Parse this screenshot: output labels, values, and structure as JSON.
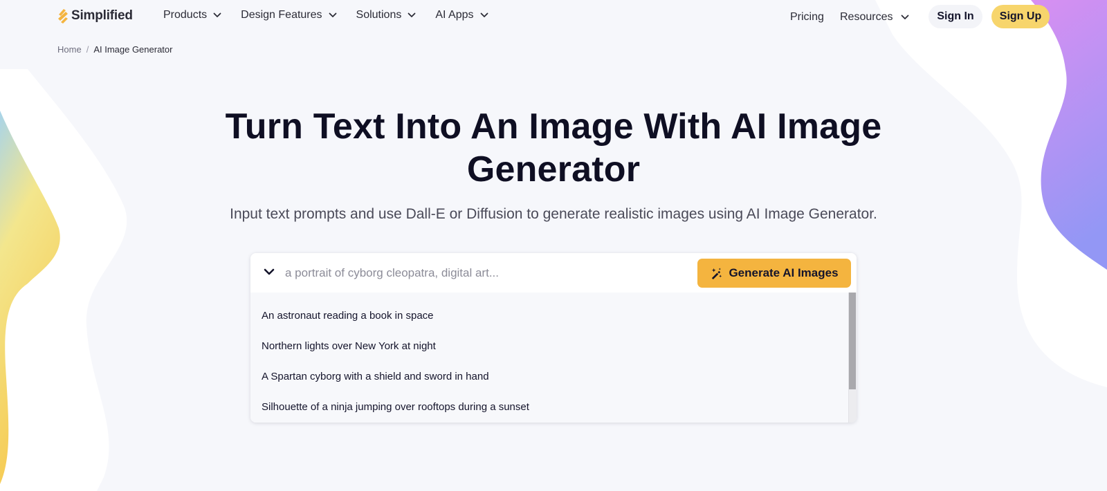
{
  "brand": {
    "name": "Simplified",
    "logo_icon": "simplified-logo-icon",
    "colors": {
      "accent_yellow": "#f7d56c",
      "button_orange": "#f4b43f",
      "text_dark": "#0f0f23",
      "page_bg": "#f6f7fb"
    }
  },
  "nav": {
    "left_items": [
      {
        "label": "Products",
        "icon": "chevron-down-icon"
      },
      {
        "label": "Design Features",
        "icon": "chevron-down-icon"
      },
      {
        "label": "Solutions",
        "icon": "chevron-down-icon"
      },
      {
        "label": "AI Apps",
        "icon": "chevron-down-icon"
      }
    ],
    "pricing_label": "Pricing",
    "resources_label": "Resources",
    "sign_in_label": "Sign In",
    "sign_up_label": "Sign Up"
  },
  "breadcrumb": {
    "home": "Home",
    "separator": "/",
    "current": "AI Image Generator"
  },
  "hero": {
    "title_line1": "Turn Text Into An Image With AI Image",
    "title_line2": "Generator",
    "subtitle": "Input text prompts and use Dall-E or Diffusion to generate realistic images using AI Image Generator."
  },
  "generator": {
    "input_value": "",
    "input_placeholder": "a portrait of cyborg cleopatra, digital art...",
    "toggle_icon": "chevron-down-icon",
    "button_icon": "magic-wand-icon",
    "button_label": "Generate AI Images",
    "suggestions": [
      "An astronaut reading a book in space",
      "Northern lights over New York at night",
      "A Spartan cyborg with a shield and sword in hand",
      "Silhouette of a ninja jumping over rooftops during a sunset"
    ]
  }
}
